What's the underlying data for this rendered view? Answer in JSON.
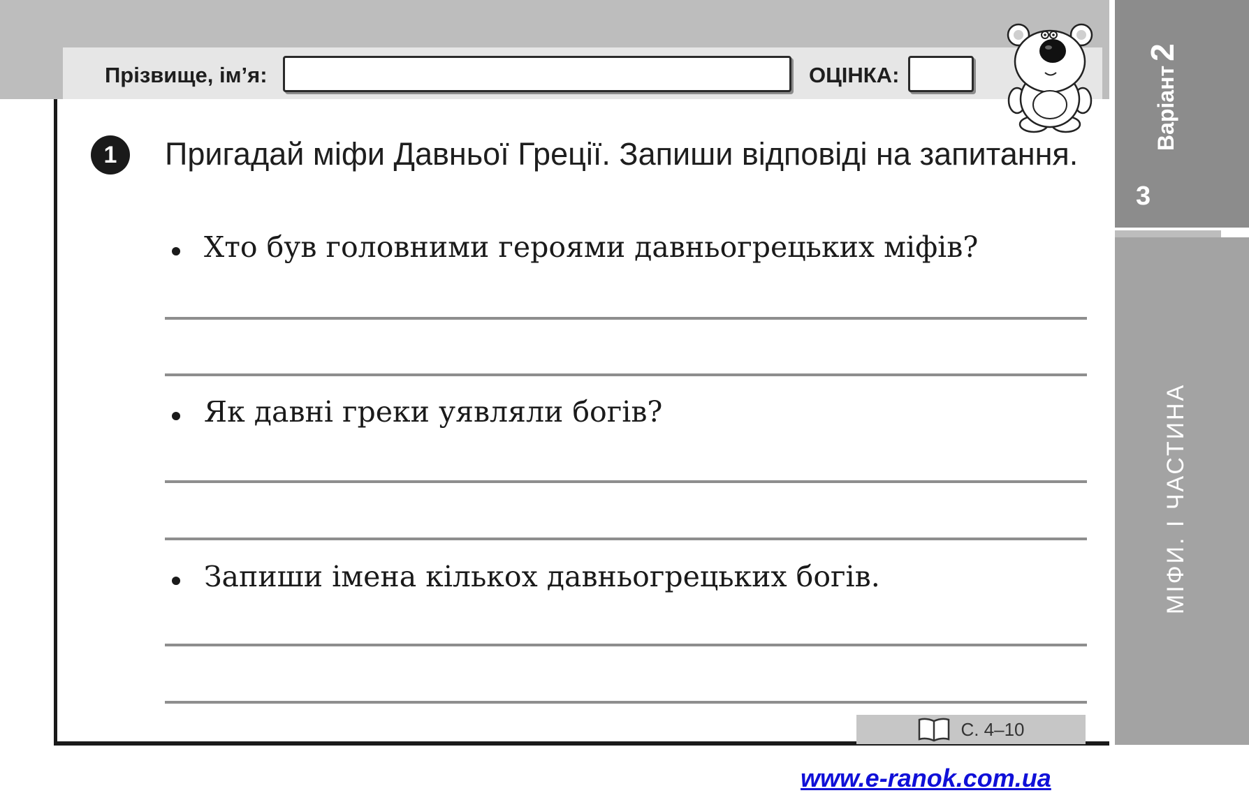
{
  "header": {
    "name_label": "Прізвище, ім’я:",
    "name_value": "",
    "grade_label": "ОЦІНКА:",
    "grade_value": ""
  },
  "sidebar": {
    "variant_label": "Варіант",
    "variant_number": "2",
    "page_number": "3",
    "section_title": "МІФИ. І ЧАСТИНА"
  },
  "task": {
    "number": "1",
    "text": "Пригадай міфи Давньої Греції. Запиши відповіді на запитання.",
    "questions": [
      {
        "text": "Хто був головними героями давньогрецьких міфів?"
      },
      {
        "text": "Як давні греки уявляли богів?"
      },
      {
        "text": "Запиши імена кількох давньогрецьких богів."
      }
    ]
  },
  "reference": {
    "text": "С. 4–10"
  },
  "footer": {
    "url": "www.e-ranok.com.ua"
  },
  "icons": {
    "bear": "bear-mascot-icon",
    "book": "open-book-icon"
  }
}
